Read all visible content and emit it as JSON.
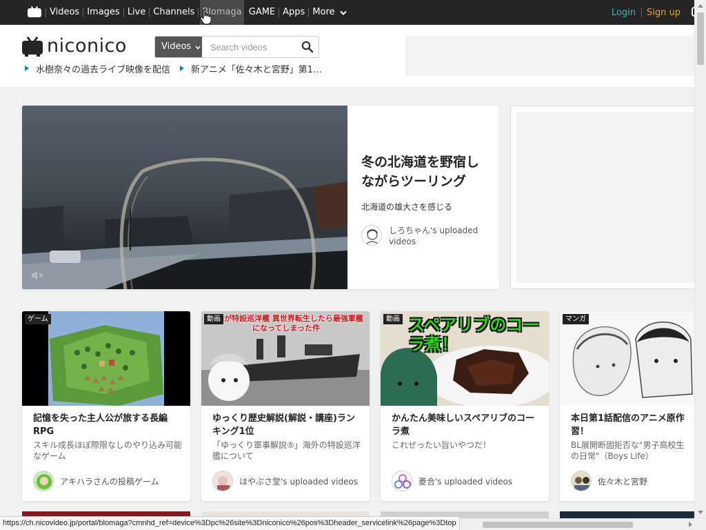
{
  "topbar": {
    "nav": [
      "Videos",
      "Images",
      "Live",
      "Channels",
      "Blomaga",
      "GAME",
      "Apps"
    ],
    "more_label": "More",
    "login_label": "Login",
    "signup_label": "Sign up",
    "colors": {
      "login": "#36b8ad",
      "signup": "#e0a83a",
      "bg": "#252525"
    }
  },
  "header": {
    "logo_text": "niconico",
    "search_category": "Videos",
    "search_placeholder": "Search videos",
    "news": [
      "水樹奈々の過去ライブ映像を配信",
      "新アニメ「佐々木と宮野」第1…"
    ]
  },
  "feature": {
    "title": "冬の北海道を野宿しながらツーリング",
    "description": "北海道の雄大さを感じる",
    "uploader": "しろちゃん's uploaded videos"
  },
  "cards": [
    {
      "tag": "ゲーム",
      "title": "記憶を失った主人公が旅する長編RPG",
      "description": "スキル成長ほぼ際限なしのやり込み可能なゲーム",
      "uploader": "アキハラさんの投稿ゲーム",
      "thumb_text": ""
    },
    {
      "tag": "動画",
      "title": "ゆっくり歴史解説(解説・講座)ランキング1位",
      "description": "「ゆっくり軍事解説⑤」海外の特設巡洋艦について",
      "uploader": "はやぶさ堂's uploaded videos",
      "thumb_text": "商船が特設巡洋艦 異世界転生したら最強軍艦になってしまった件"
    },
    {
      "tag": "動画",
      "title": "かんたん美味しいスペアリブのコーラ煮",
      "description": "これぜったい旨いやつだ！",
      "uploader": "菱合's uploaded videos",
      "thumb_text": "スペアリブのコーラ煮！"
    },
    {
      "tag": "マンガ",
      "title": "本日第1話配信のアニメ原作習！",
      "description": "BL展開断固拒否な\"男子高校生の日常\"（Boys Life）",
      "uploader": "佐々木と宮野",
      "thumb_text": ""
    }
  ],
  "statusbar": {
    "url": "https://ch.nicovideo.jp/portal/blomaga?cmnhd_ref=device%3Dpc%26site%3Dniconico%26pos%3Dheader_servicelink%26page%3Dtop"
  }
}
